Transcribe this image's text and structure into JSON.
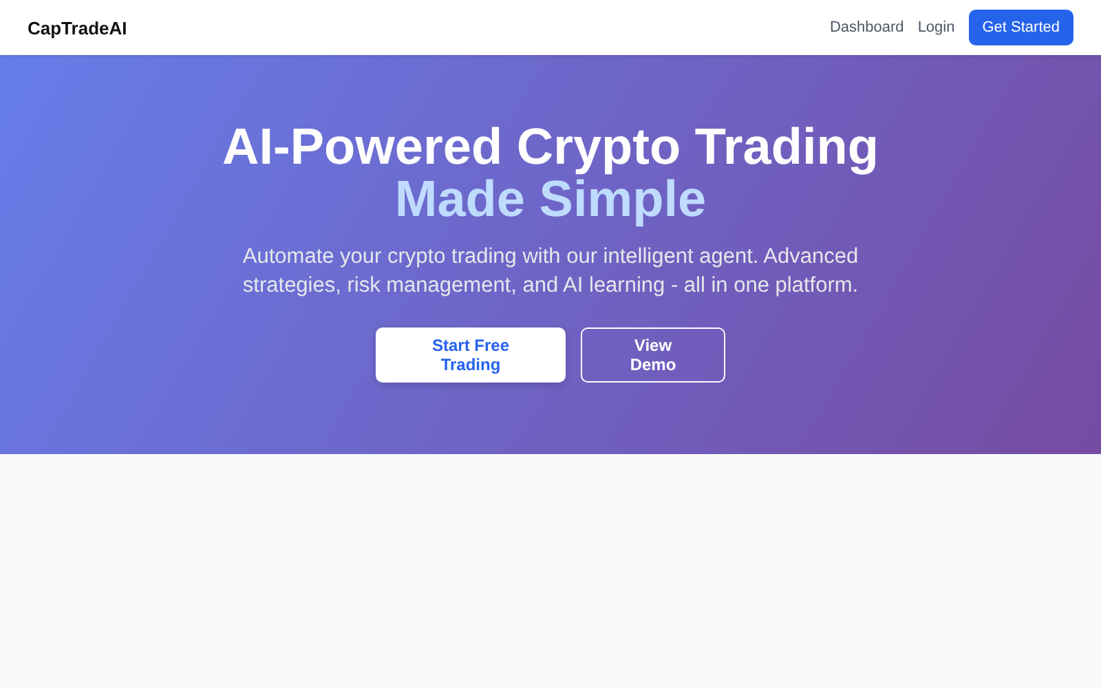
{
  "header": {
    "brand": "CapTradeAI",
    "nav": [
      {
        "label": "Dashboard",
        "kind": "link"
      },
      {
        "label": "Login",
        "kind": "link"
      },
      {
        "label": "Get Started",
        "kind": "button"
      }
    ]
  },
  "hero": {
    "title": "AI-Powered Crypto Trading",
    "highlight": "Made Simple",
    "subtitle": "Automate your crypto trading with our intelligent agent. Advanced strategies, risk management, and AI learning - all in one platform.",
    "buttons": [
      {
        "label": "Start Free Trading",
        "kind": "primary"
      },
      {
        "label": "View Demo",
        "kind": "outline"
      }
    ]
  }
}
